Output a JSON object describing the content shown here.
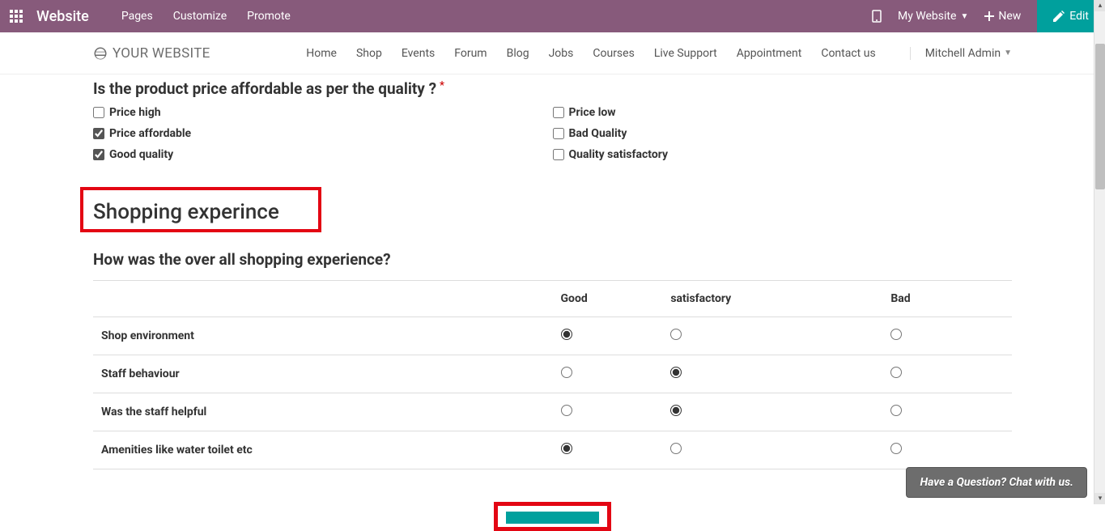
{
  "top_nav": {
    "brand": "Website",
    "menu": [
      "Pages",
      "Customize",
      "Promote"
    ],
    "my_website": "My Website",
    "new_label": "New",
    "edit_label": "Edit"
  },
  "sub_nav": {
    "site_name": "YOUR WEBSITE",
    "items": [
      "Home",
      "Shop",
      "Events",
      "Forum",
      "Blog",
      "Jobs",
      "Courses",
      "Live Support",
      "Appointment",
      "Contact us"
    ],
    "user": "Mitchell Admin"
  },
  "survey": {
    "price_question": "Is the product price affordable as per the quality ?",
    "check_left": [
      {
        "label": "Price high",
        "checked": false
      },
      {
        "label": "Price affordable",
        "checked": true
      },
      {
        "label": "Good quality",
        "checked": true
      }
    ],
    "check_right": [
      {
        "label": "Price low",
        "checked": false
      },
      {
        "label": "Bad Quality",
        "checked": false
      },
      {
        "label": "Quality satisfactory",
        "checked": false
      }
    ],
    "section_title": "Shopping experince",
    "matrix_question": "How was the over all shopping experience?",
    "columns": [
      "Good",
      "satisfactory",
      "Bad"
    ],
    "rows": [
      {
        "label": "Shop environment",
        "selected": 0
      },
      {
        "label": "Staff behaviour",
        "selected": 1
      },
      {
        "label": "Was the staff helpful",
        "selected": 1
      },
      {
        "label": "Amenities like water toilet etc",
        "selected": 0
      }
    ]
  },
  "chat": "Have a Question? Chat with us."
}
